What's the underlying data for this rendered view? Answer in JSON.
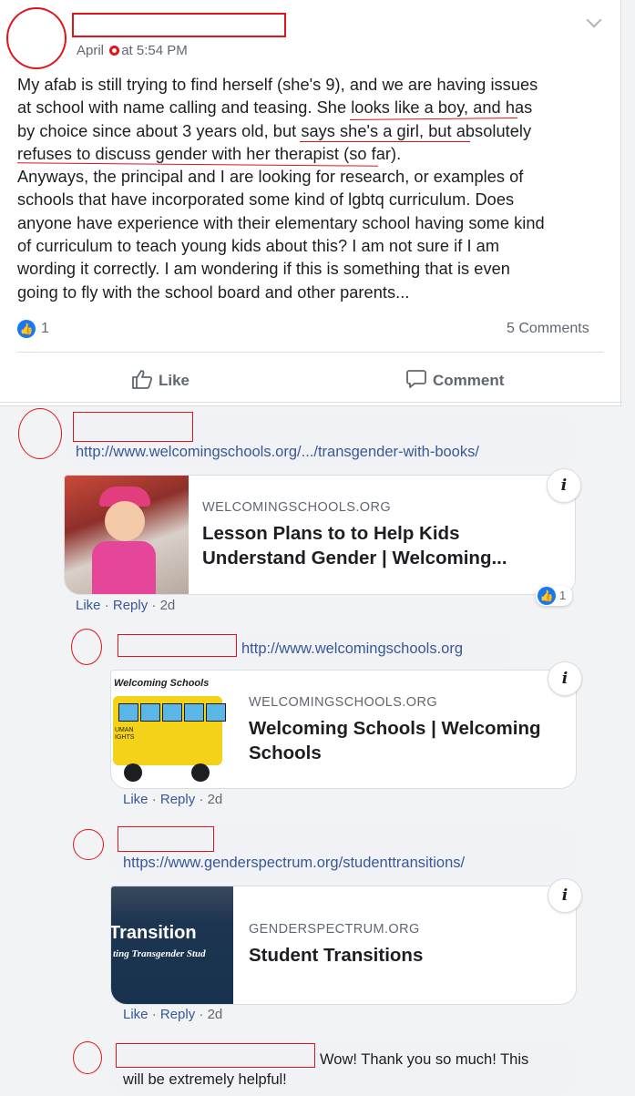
{
  "post": {
    "date_prefix": "April",
    "date_suffix": "at 5:54 PM",
    "text": "My afab is still trying to find herself (she's 9), and we are having issues\nat school with name calling and teasing. She looks like a boy, and has\nby choice since about 3 years old, but says she's a girl, but absolutely\nrefuses to discuss gender with her therapist (so far).\nAnyways, the principal and I are looking for research, or examples of\nschools that have incorporated some kind of lgbtq curriculum. Does\nanyone have experience with their elementary school having some kind\nof curriculum to teach young kids about this? I am not sure if I am\nwording it correctly. I am wondering if this is something that is even\ngoing to fly with the school board and other parents...",
    "reaction_count": "1",
    "comments_count": "5 Comments",
    "like_label": "Like",
    "comment_label": "Comment"
  },
  "comments": [
    {
      "link": "http://www.welcomingschools.org/.../transgender-with-books/",
      "preview_site": "WELCOMINGSCHOOLS.ORG",
      "preview_title": "Lesson Plans to to Help Kids\nUnderstand Gender | Welcoming...",
      "actions": {
        "like": "Like",
        "reply": "Reply",
        "age": "2d"
      },
      "reaction_count": "1"
    },
    {
      "link": "http://www.welcomingschools.org",
      "preview_site": "WELCOMINGSCHOOLS.ORG",
      "preview_title": "Welcoming Schools | Welcoming\nSchools",
      "preview_image_text": "Welcoming Schools",
      "preview_image_subtext": "UMAN\nIGHTS",
      "actions": {
        "like": "Like",
        "reply": "Reply",
        "age": "2d"
      }
    },
    {
      "link": "https://www.genderspectrum.org/studenttransitions/",
      "preview_site": "GENDERSPECTRUM.ORG",
      "preview_title": "Student Transitions",
      "preview_image_text": "Transition",
      "preview_image_subtext": "ting Transgender Stud",
      "actions": {
        "like": "Like",
        "reply": "Reply",
        "age": "2d"
      }
    },
    {
      "text": "Wow! Thank you so much! This\nwill be extremely helpful!"
    }
  ],
  "colors": {
    "accent": "#1877f2",
    "link": "#385898",
    "redaction": "#e0141a"
  }
}
